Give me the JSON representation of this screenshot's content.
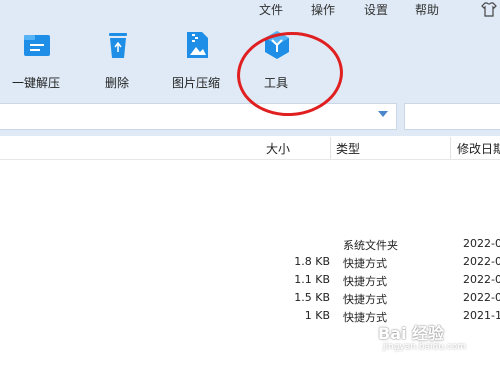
{
  "menu": {
    "items": [
      "文件",
      "操作",
      "设置",
      "帮助"
    ],
    "skin_icon": "tshirt-icon"
  },
  "toolbar": {
    "items": [
      {
        "label": "一键解压",
        "icon": "folder-extract-icon"
      },
      {
        "label": "删除",
        "icon": "recycle-bin-icon"
      },
      {
        "label": "图片压缩",
        "icon": "image-compress-icon"
      },
      {
        "label": "工具",
        "icon": "tools-cube-icon"
      }
    ]
  },
  "address": {
    "value": "",
    "search_value": ""
  },
  "columns": {
    "size": "大小",
    "type": "类型",
    "date": "修改日期"
  },
  "rows": [
    {
      "size": "",
      "type": "系统文件夹",
      "date": "2022-0"
    },
    {
      "size": "1.8 KB",
      "type": "快捷方式",
      "date": "2022-0"
    },
    {
      "size": "1.1 KB",
      "type": "快捷方式",
      "date": "2022-0"
    },
    {
      "size": "1.5 KB",
      "type": "快捷方式",
      "date": "2022-0"
    },
    {
      "size": "1 KB",
      "type": "快捷方式",
      "date": "2021-1"
    }
  ],
  "watermark": {
    "text": "Bai 经验",
    "sub": "jingyan.baidu.com"
  },
  "colors": {
    "accent": "#1e8ee6",
    "toolbar_bg": "#dfeaf6",
    "annotation": "#e02020"
  }
}
